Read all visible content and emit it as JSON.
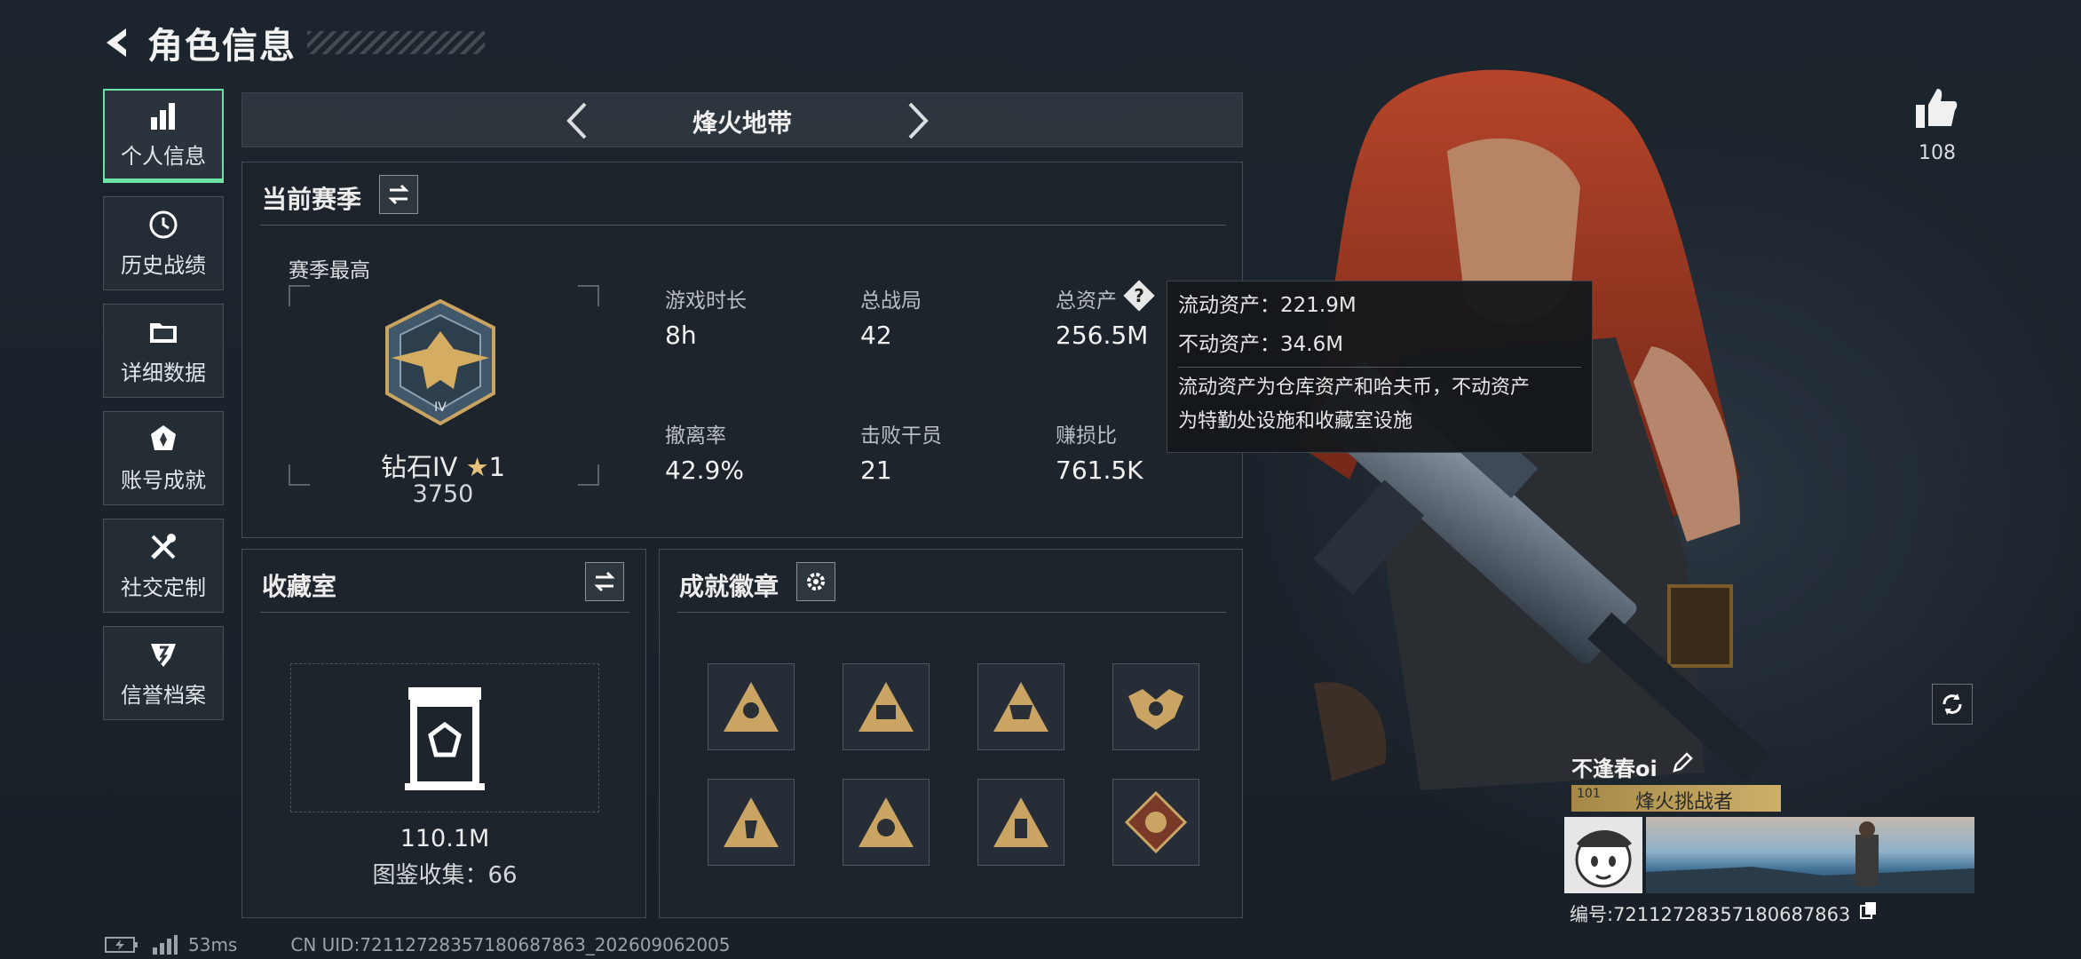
{
  "header": {
    "title": "角色信息"
  },
  "sidebar": {
    "items": [
      {
        "label": "个人信息",
        "icon": "bar-chart-icon"
      },
      {
        "label": "历史战绩",
        "icon": "clock-icon"
      },
      {
        "label": "详细数据",
        "icon": "folder-icon"
      },
      {
        "label": "账号成就",
        "icon": "badge-icon"
      },
      {
        "label": "社交定制",
        "icon": "tools-icon"
      },
      {
        "label": "信誉档案",
        "icon": "shield-icon"
      }
    ]
  },
  "mode": {
    "title": "烽火地带"
  },
  "season": {
    "title": "当前赛季",
    "best_label": "赛季最高",
    "rank_name": "钻石IV",
    "rank_stars": "1",
    "rank_score": "3750",
    "stats": [
      {
        "label": "游戏时长",
        "value": "8h"
      },
      {
        "label": "总战局",
        "value": "42"
      },
      {
        "label": "总资产",
        "value": "256.5M"
      },
      {
        "label": "撤离率",
        "value": "42.9%"
      },
      {
        "label": "击败干员",
        "value": "21"
      },
      {
        "label": "赚损比",
        "value": "761.5K"
      }
    ]
  },
  "tooltip": {
    "liquid": "流动资产：221.9M",
    "fixed": "不动资产：34.6M",
    "desc_line1": "流动资产为仓库资产和哈夫币，不动资产",
    "desc_line2": "为特勤处设施和收藏室设施"
  },
  "collection": {
    "title": "收藏室",
    "value": "110.1M",
    "index": "图鉴收集：66"
  },
  "achievements": {
    "title": "成就徽章"
  },
  "likes": {
    "count": "108"
  },
  "player": {
    "name": "不逢春oi",
    "title": "烽火挑战者",
    "level": "101",
    "id": "编号:72112728357180687863"
  },
  "footer": {
    "ping": "53ms",
    "uid": "CN UID:72112728357180687863_202609062005"
  },
  "colors": {
    "accent": "#6de3a6",
    "gold": "#c9a463",
    "panel": "#1e252c"
  }
}
